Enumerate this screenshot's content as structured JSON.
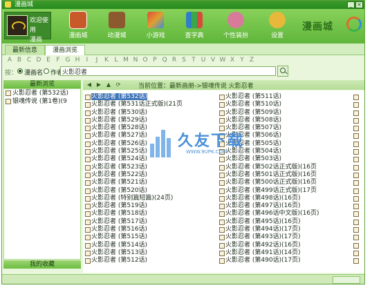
{
  "window": {
    "title": "漫画城",
    "btn_min": "_",
    "btn_close": "×"
  },
  "profile": {
    "line1": "欢迎使用",
    "line2": "漫画"
  },
  "toolbar": {
    "items": [
      {
        "label": "漫画城",
        "icon": "house-icon",
        "color": "#c85a2a"
      },
      {
        "label": "动漫城",
        "icon": "box-icon",
        "color": "#8c5a2e"
      },
      {
        "label": "小游戏",
        "icon": "puzzle-icon",
        "color": "#e0a030"
      },
      {
        "label": "查字典",
        "icon": "books-icon",
        "color": "#2f7fc8"
      },
      {
        "label": "个性装扮",
        "icon": "person-icon",
        "color": "#d87a9a"
      },
      {
        "label": "设置",
        "icon": "gear-icon",
        "color": "#e8b83a"
      }
    ]
  },
  "brand": {
    "text": "漫画城"
  },
  "tabs": [
    {
      "label": "最新信息"
    },
    {
      "label": "漫画浏览"
    }
  ],
  "alphabet": [
    "A",
    "B",
    "C",
    "D",
    "E",
    "F",
    "G",
    "H",
    "I",
    "J",
    "K",
    "L",
    "M",
    "N",
    "O",
    "P",
    "Q",
    "R",
    "S",
    "T",
    "U",
    "V",
    "W",
    "X",
    "Y",
    "Z"
  ],
  "search": {
    "prefix": "按：",
    "option1": "漫画名",
    "option2": "作者",
    "value": "火影忍者"
  },
  "left_panel": {
    "header": "最新浏览",
    "items": [
      {
        "label": "火影忍者 (第532话)"
      },
      {
        "label": "银魂传说 (第1卷)(9"
      }
    ],
    "footer": "我的收藏"
  },
  "nav": {
    "path": "当前位置：最新画册->银魂传说 火影忍者"
  },
  "content": {
    "col1": [
      "火影忍者 (第532话)",
      "火影忍者 (第531话正式版)(21页",
      "火影忍者 (第530话)",
      "火影忍者 (第529话)",
      "火影忍者 (第528话)",
      "火影忍者 (第527话)",
      "火影忍者 (第526话)",
      "火影忍者 (第525话)",
      "火影忍者 (第524话)",
      "火影忍者 (第523话)",
      "火影忍者 (第522话)",
      "火影忍者 (第521话)",
      "火影忍者 (第520话)",
      "火影忍者 (特别篇短篇)(24页)",
      "火影忍者 (第519话)",
      "火影忍者 (第518话)",
      "火影忍者 (第517话)",
      "火影忍者 (第516话)",
      "火影忍者 (第515话)",
      "火影忍者 (第514话)",
      "火影忍者 (第513话)",
      "火影忍者 (第512话)"
    ],
    "col2": [
      "火影忍者 (第511话)",
      "火影忍者 (第510话)",
      "火影忍者 (第509话)",
      "火影忍者 (第508话)",
      "火影忍者 (第507话)",
      "火影忍者 (第506话)",
      "火影忍者 (第505话)",
      "火影忍者 (第504话)",
      "火影忍者 (第503话)",
      "火影忍者 (第502话正式版)(16页",
      "火影忍者 (第501话正式版)(16页",
      "火影忍者 (第500话正式版)(16页",
      "火影忍者 (第499话正式版)(17页",
      "火影忍者 (第498话)(16页)",
      "火影忍者 (第497话)(16页)",
      "火影忍者 (第496话中文版)(16页)",
      "火影忍者 (第495话)(16页)",
      "火影忍者 (第494话)(17页)",
      "火影忍者 (第493话)(17页)",
      "火影忍者 (第492话)(16页)",
      "火影忍者 (第491话)(14页)",
      "火影忍者 (第490话)(17页)"
    ],
    "selected_index": 0
  },
  "watermark": {
    "text": "久友下载",
    "url": "WWW.9UPK.COM"
  },
  "status": {
    "label": "我的收藏"
  }
}
